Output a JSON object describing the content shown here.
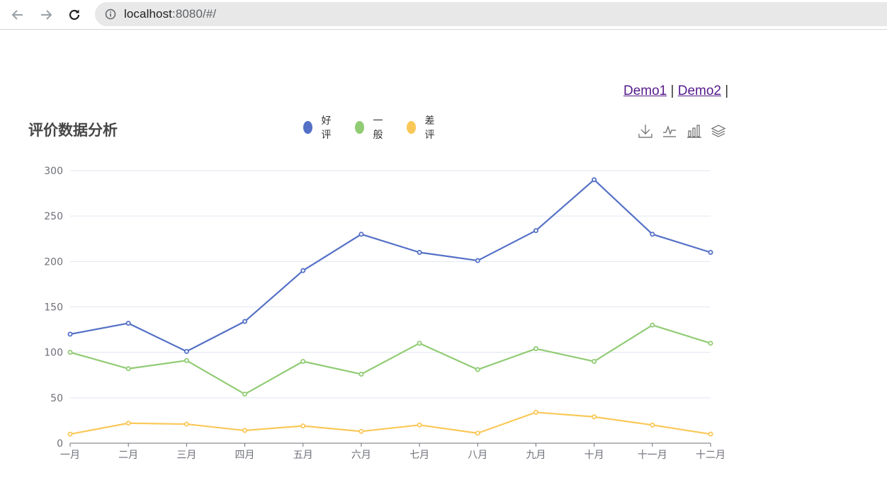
{
  "browser": {
    "url_host": "localhost",
    "url_rest": ":8080/#/"
  },
  "links": {
    "demo1": "Demo1",
    "demo2": "Demo2",
    "sep1": " | ",
    "sep2": " |"
  },
  "chart_data": {
    "type": "line",
    "title": "评价数据分析",
    "categories": [
      "一月",
      "二月",
      "三月",
      "四月",
      "五月",
      "六月",
      "七月",
      "八月",
      "九月",
      "十月",
      "十一月",
      "十二月"
    ],
    "series": [
      {
        "name": "好评",
        "color": "#5470c6",
        "values": [
          120,
          132,
          101,
          134,
          190,
          230,
          210,
          201,
          234,
          290,
          230,
          210
        ]
      },
      {
        "name": "一般",
        "color": "#91cc75",
        "values": [
          100,
          82,
          91,
          54,
          90,
          76,
          110,
          81,
          104,
          90,
          130,
          110
        ]
      },
      {
        "name": "差评",
        "color": "#fac858",
        "values": [
          10,
          22,
          21,
          14,
          19,
          13,
          20,
          11,
          34,
          29,
          20,
          10
        ]
      }
    ],
    "ylim": [
      0,
      300
    ],
    "yticks": [
      0,
      50,
      100,
      150,
      200,
      250,
      300
    ],
    "grid": true,
    "legend_position": "top-center"
  },
  "toolbox": {
    "icons": [
      "download-icon",
      "line-chart-icon",
      "bar-chart-icon",
      "stack-icon"
    ]
  }
}
